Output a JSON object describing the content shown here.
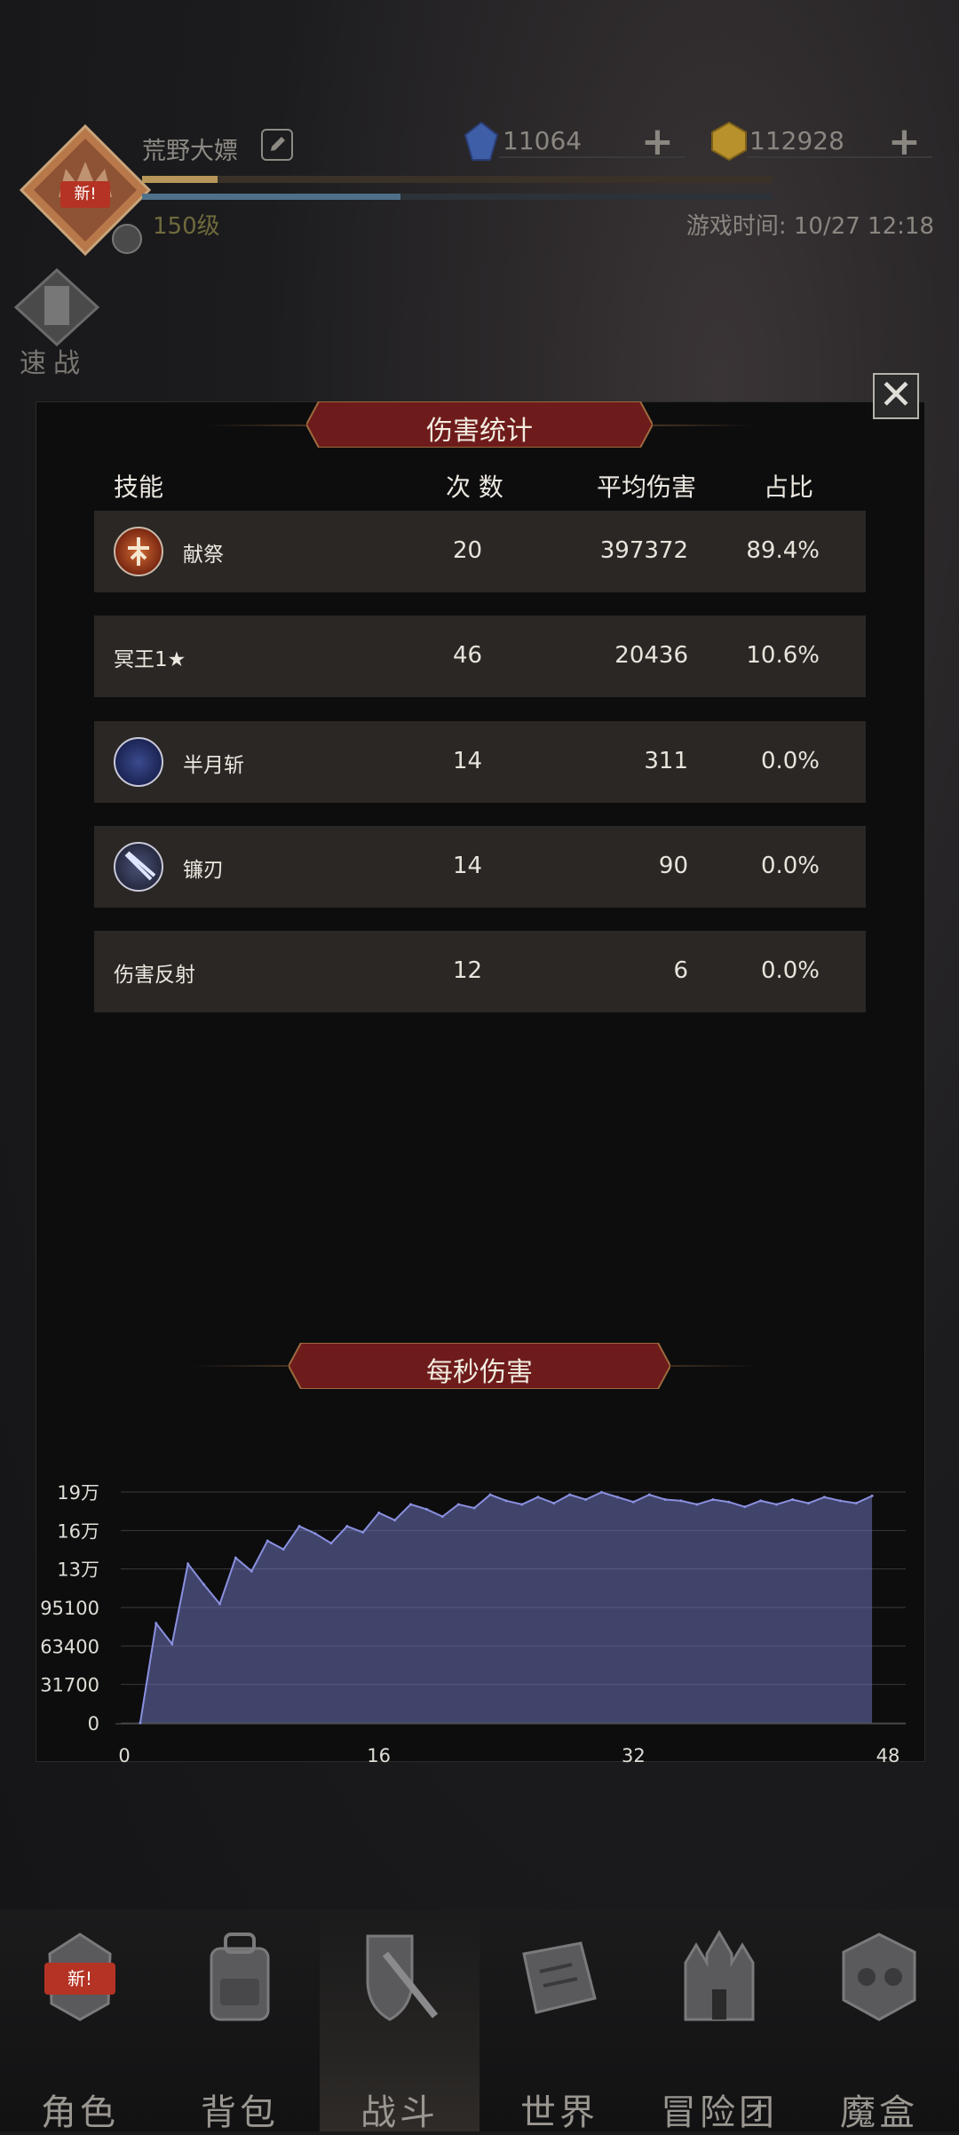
{
  "header": {
    "player_name": "荒野大嫖",
    "avatar_badge": "新!",
    "level": "150级",
    "game_time": "游戏时间: 10/27 12:18",
    "currency": [
      {
        "name": "gem",
        "value": "11064",
        "color": "#3f5ea8"
      },
      {
        "name": "gold",
        "value": "112928",
        "color": "#b8902c"
      }
    ],
    "exp_progress": 0.12,
    "energy_progress": 0.41,
    "quick_battle": "速战"
  },
  "damage_stats": {
    "title": "伤害统计",
    "columns": {
      "skill": "技能",
      "count": "次 数",
      "avg": "平均伤害",
      "ratio": "占比"
    },
    "rows": [
      {
        "skill": "献祭",
        "count": "20",
        "avg": "397372",
        "ratio": "89.4%",
        "icon": "sacrifice-icon",
        "has_icon": true
      },
      {
        "skill": "冥王1★",
        "count": "46",
        "avg": "20436",
        "ratio": "10.6%",
        "icon": "",
        "has_icon": false
      },
      {
        "skill": "半月斩",
        "count": "14",
        "avg": "311",
        "ratio": "0.0%",
        "icon": "half-moon-slash-icon",
        "has_icon": true
      },
      {
        "skill": "镰刃",
        "count": "14",
        "avg": "90",
        "ratio": "0.0%",
        "icon": "scythe-blade-icon",
        "has_icon": true
      },
      {
        "skill": "伤害反射",
        "count": "12",
        "avg": "6",
        "ratio": "0.0%",
        "icon": "",
        "has_icon": false
      }
    ]
  },
  "dps": {
    "title": "每秒伤害"
  },
  "chart_data": {
    "type": "area",
    "title": "每秒伤害",
    "xlabel": "",
    "ylabel": "",
    "y_ticks": [
      "0",
      "31700",
      "63400",
      "95100",
      "13万",
      "16万",
      "19万"
    ],
    "y_tick_values": [
      0,
      31700,
      63400,
      95100,
      126800,
      158500,
      190200
    ],
    "x_ticks": [
      "0",
      "16",
      "32",
      "48"
    ],
    "x_tick_values": [
      0,
      16,
      32,
      48
    ],
    "xlim": [
      0,
      48
    ],
    "ylim": [
      0,
      190200
    ],
    "grid": true,
    "color": "#6e72b6",
    "x": [
      1,
      2,
      3,
      4,
      5,
      6,
      7,
      8,
      9,
      10,
      11,
      12,
      13,
      14,
      15,
      16,
      17,
      18,
      19,
      20,
      21,
      22,
      23,
      24,
      25,
      26,
      27,
      28,
      29,
      30,
      31,
      32,
      33,
      34,
      35,
      36,
      37,
      38,
      39,
      40,
      41,
      42,
      43,
      44,
      45,
      46,
      47
    ],
    "values": [
      0,
      82000,
      65000,
      131000,
      114000,
      98000,
      136000,
      125000,
      150000,
      143000,
      162000,
      156000,
      148000,
      162000,
      157000,
      173000,
      167000,
      180000,
      176000,
      170000,
      180000,
      177000,
      188000,
      183000,
      180000,
      186000,
      181000,
      188000,
      184000,
      190000,
      186000,
      182000,
      188000,
      184000,
      183000,
      180000,
      184000,
      182000,
      178000,
      183000,
      180000,
      184000,
      181000,
      186000,
      183000,
      181000,
      187000
    ]
  },
  "nav": {
    "items": [
      {
        "label": "角色",
        "icon": "helmet-icon",
        "badge": "新!"
      },
      {
        "label": "背包",
        "icon": "backpack-icon"
      },
      {
        "label": "战斗",
        "icon": "shield-sword-icon",
        "active": true
      },
      {
        "label": "世界",
        "icon": "map-scroll-icon"
      },
      {
        "label": "冒险团",
        "icon": "castle-icon"
      },
      {
        "label": "魔盒",
        "icon": "magic-cube-icon"
      }
    ]
  }
}
